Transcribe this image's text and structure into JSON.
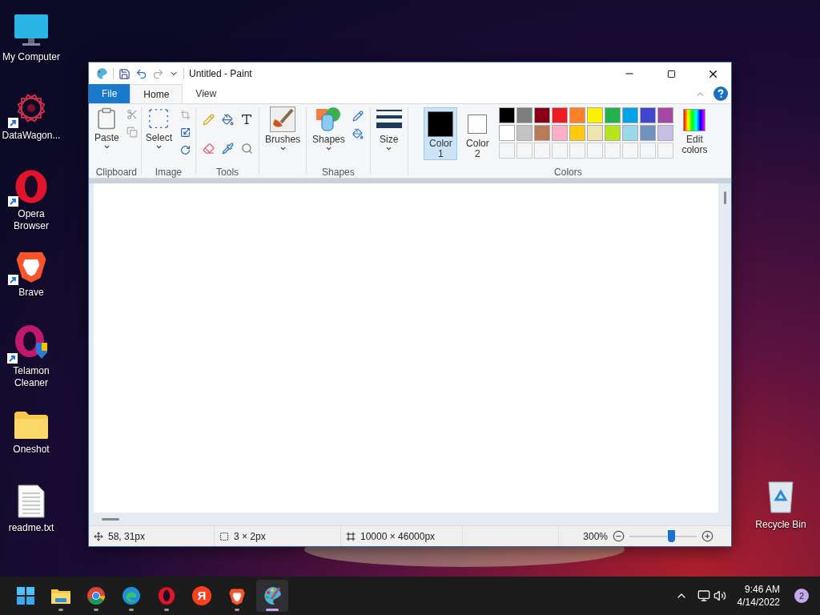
{
  "desktop_icons": [
    {
      "label": "My Computer",
      "kind": "computer",
      "shortcut": false
    },
    {
      "label": "DataWagon...",
      "kind": "star",
      "shortcut": true
    },
    {
      "label": "Opera Browser",
      "kind": "opera",
      "shortcut": true
    },
    {
      "label": "Brave",
      "kind": "brave",
      "shortcut": true
    },
    {
      "label": "Telamon Cleaner",
      "kind": "telamon",
      "shortcut": true
    },
    {
      "label": "Oneshot",
      "kind": "folder",
      "shortcut": false
    },
    {
      "label": "readme.txt",
      "kind": "text",
      "shortcut": false
    }
  ],
  "recycle_bin": {
    "label": "Recycle Bin"
  },
  "window": {
    "title": "Untitled - Paint",
    "tabs": [
      {
        "label": "File",
        "kind": "file",
        "selected": false
      },
      {
        "label": "Home",
        "kind": "tab",
        "selected": true
      },
      {
        "label": "View",
        "kind": "tab",
        "selected": false
      }
    ],
    "ribbon": {
      "paste": "Paste",
      "clipboard": "Clipboard",
      "select": "Select",
      "image": "Image",
      "tools": "Tools",
      "brushes": "Brushes",
      "shapes_button": "Shapes",
      "shapes_group": "Shapes",
      "size": "Size",
      "colors_group": "Colors",
      "edit_colors": "Edit colors",
      "chosen": [
        {
          "label": "Color 1",
          "color": "#000000",
          "selected": true
        },
        {
          "label": "Color 2",
          "color": "#ffffff",
          "selected": false
        }
      ],
      "palette": [
        {
          "color": "#000000"
        },
        {
          "color": "#7f7f7f"
        },
        {
          "color": "#880015"
        },
        {
          "color": "#ed1c24"
        },
        {
          "color": "#ff7f27"
        },
        {
          "color": "#fff200"
        },
        {
          "color": "#22b14c"
        },
        {
          "color": "#00a2e8"
        },
        {
          "color": "#3f48cc"
        },
        {
          "color": "#a349a4"
        },
        {
          "color": "#ffffff"
        },
        {
          "color": "#c3c3c3"
        },
        {
          "color": "#b97a57"
        },
        {
          "color": "#ffaec9"
        },
        {
          "color": "#ffc90e"
        },
        {
          "color": "#efe4b0"
        },
        {
          "color": "#b5e61d"
        },
        {
          "color": "#99d9ea"
        },
        {
          "color": "#7092be"
        },
        {
          "color": "#c8bfe7"
        }
      ]
    },
    "status": {
      "position": "58, 31px",
      "selection": "3 × 2px",
      "canvas_size": "10000 × 46000px",
      "zoom": "300%",
      "zoom_slider": {
        "level": 0.62
      }
    }
  },
  "taskbar": {
    "apps": [
      {
        "kind": "start",
        "running": false,
        "active": false
      },
      {
        "kind": "explorer",
        "running": true,
        "active": false
      },
      {
        "kind": "chrome",
        "running": true,
        "active": false
      },
      {
        "kind": "edge",
        "running": true,
        "active": false
      },
      {
        "kind": "opera",
        "running": true,
        "active": false
      },
      {
        "kind": "yandex",
        "glyph": "Я",
        "running": false,
        "active": false
      },
      {
        "kind": "brave",
        "running": true,
        "active": false
      },
      {
        "kind": "paint",
        "running": true,
        "active": true
      }
    ],
    "time": "9:46 AM",
    "date": "4/14/2022",
    "notifications": "2"
  }
}
